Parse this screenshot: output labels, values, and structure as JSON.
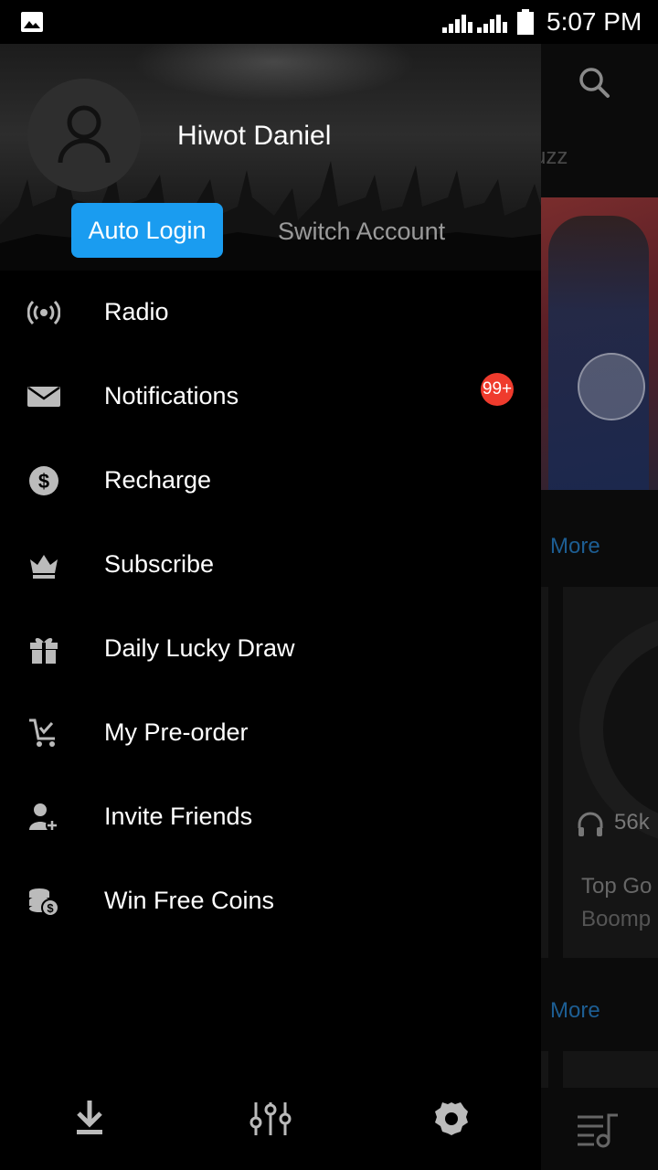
{
  "status_bar": {
    "time": "5:07 PM"
  },
  "background": {
    "tab_partial": "uzz",
    "more_label": "More",
    "play_count": "56k",
    "card_title": "Top Go",
    "card_subtitle": "Boomp"
  },
  "drawer": {
    "username": "Hiwot Daniel",
    "auto_login": "Auto Login",
    "switch_account": "Switch Account",
    "menu": [
      {
        "label": "Radio",
        "icon": "radio-icon"
      },
      {
        "label": "Notifications",
        "icon": "mail-icon",
        "badge": "99+"
      },
      {
        "label": "Recharge",
        "icon": "dollar-icon"
      },
      {
        "label": "Subscribe",
        "icon": "crown-icon"
      },
      {
        "label": "Daily Lucky Draw",
        "icon": "gift-icon"
      },
      {
        "label": "My Pre-order",
        "icon": "cart-icon"
      },
      {
        "label": "Invite Friends",
        "icon": "add-user-icon"
      },
      {
        "label": "Win Free Coins",
        "icon": "coins-icon"
      }
    ],
    "footer": [
      "download-icon",
      "equalizer-icon",
      "settings-icon"
    ]
  },
  "colors": {
    "accent": "#1a9cf0",
    "badge": "#ef3b2d",
    "link": "#1d5e93"
  }
}
